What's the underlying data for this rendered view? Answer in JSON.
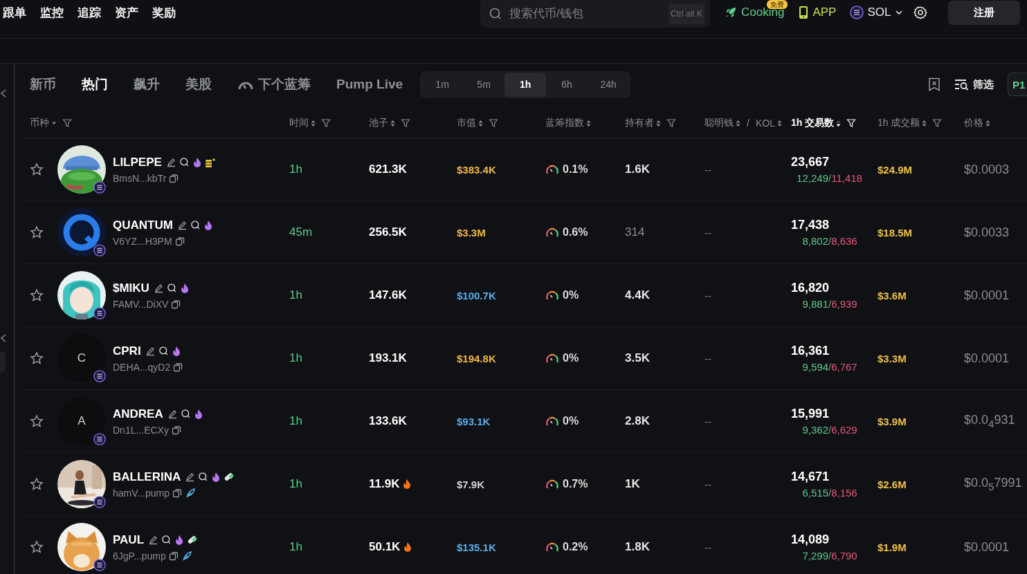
{
  "nav": [
    "跟单",
    "监控",
    "追踪",
    "资产",
    "奖励"
  ],
  "search": {
    "placeholder": "搜索代币/钱包",
    "shortcut": "Ctrl alt K"
  },
  "header_actions": {
    "cooking": {
      "label": "Cooking",
      "badge": "免费"
    },
    "app": "APP",
    "chain": "SOL",
    "signup": "注册"
  },
  "tabs": [
    {
      "label": "新币",
      "selected": false
    },
    {
      "label": "热门",
      "selected": true
    },
    {
      "label": "飙升",
      "selected": false
    },
    {
      "label": "美股",
      "selected": false
    },
    {
      "label": "下个蓝筹",
      "selected": false,
      "kind": "indicator"
    },
    {
      "label": "Pump Live",
      "selected": false
    }
  ],
  "timeframes": [
    {
      "label": "1m",
      "selected": false
    },
    {
      "label": "5m",
      "selected": false
    },
    {
      "label": "1h",
      "selected": true
    },
    {
      "label": "6h",
      "selected": false
    },
    {
      "label": "24h",
      "selected": false
    }
  ],
  "toolbar": {
    "filter": "筛选",
    "preset": "P1"
  },
  "columns": [
    {
      "label": "币种",
      "dropdown": true,
      "filter": true,
      "active": false
    },
    {
      "label": "时间",
      "dropdown": false,
      "sortable": true,
      "sorted_desc": false,
      "filter": true,
      "active": false
    },
    {
      "label": "池子",
      "dropdown": false,
      "sortable": true,
      "sorted_desc": false,
      "filter": true,
      "active": false
    },
    {
      "label": "市值",
      "dropdown": false,
      "sortable": true,
      "sorted_desc": false,
      "filter": true,
      "active": false
    },
    {
      "label": "蓝筹指数",
      "dropdown": false,
      "sortable": true,
      "sorted_desc": false,
      "filter": false,
      "active": false
    },
    {
      "label": "持有者",
      "dropdown": false,
      "sortable": true,
      "sorted_desc": false,
      "filter": true,
      "active": false
    },
    {
      "label": "聪明钱",
      "dropdown": false,
      "sortable": true,
      "sorted_desc": false,
      "filter": false,
      "active": false,
      "separator": "/",
      "label_2": "KOL"
    },
    {
      "label": "1h 交易数",
      "dropdown": false,
      "sortable": true,
      "sorted_desc": true,
      "filter": true,
      "active": true
    },
    {
      "label": "1h 成交额",
      "dropdown": false,
      "sortable": true,
      "sorted_desc": false,
      "filter": true,
      "active": false
    },
    {
      "label": "价格",
      "dropdown": false,
      "sortable": true,
      "sorted_desc": false,
      "filter": false,
      "active": false
    }
  ],
  "rows": [
    {
      "favorite": false,
      "avatar": {
        "kind": "picture"
      },
      "name": "LILPEPE",
      "badges": [
        {
          "kind": "coins"
        }
      ],
      "address": "BmsN...kbTr",
      "social": false,
      "time": "1h",
      "pool": "621.3K",
      "pool_hot": false,
      "market_cap": {
        "value": "$383.4K",
        "color": "#f0b94a"
      },
      "bluechip": "0.1%",
      "holders": {
        "value": "1.6K",
        "dim": false
      },
      "smart_money": "--",
      "txns": "23,667",
      "buys": "12,249",
      "separator": "/",
      "sells": "11,418",
      "volume": "$24.9M",
      "price": "$0.0003"
    },
    {
      "favorite": false,
      "avatar": {
        "kind": "picture"
      },
      "name": "QUANTUM",
      "badges": [],
      "address": "V6YZ...H3PM",
      "social": false,
      "time": "45m",
      "pool": "256.5K",
      "pool_hot": false,
      "market_cap": {
        "value": "$3.3M",
        "color": "#f0b94a"
      },
      "bluechip": "0.6%",
      "holders": {
        "value": "314",
        "dim": true
      },
      "smart_money": "--",
      "txns": "17,438",
      "buys": "8,802",
      "separator": "/",
      "sells": "8,636",
      "volume": "$18.5M",
      "price": "$0.0033"
    },
    {
      "favorite": false,
      "avatar": {
        "kind": "picture"
      },
      "name": "$MIKU",
      "badges": [],
      "address": "FAMV...DiXV",
      "social": false,
      "time": "1h",
      "pool": "147.6K",
      "pool_hot": false,
      "market_cap": {
        "value": "$100.7K",
        "color": "#5aaee8"
      },
      "bluechip": "0%",
      "holders": {
        "value": "4.4K",
        "dim": false
      },
      "smart_money": "--",
      "txns": "16,820",
      "buys": "9,881",
      "separator": "/",
      "sells": "6,939",
      "volume": "$3.6M",
      "price": "$0.0001"
    },
    {
      "favorite": false,
      "avatar": {
        "kind": "letter",
        "letter": "C"
      },
      "name": "CPRI",
      "badges": [],
      "address": "DEHA...qyD2",
      "social": false,
      "time": "1h",
      "pool": "193.1K",
      "pool_hot": false,
      "market_cap": {
        "value": "$194.8K",
        "color": "#f0b94a"
      },
      "bluechip": "0%",
      "holders": {
        "value": "3.5K",
        "dim": false
      },
      "smart_money": "--",
      "txns": "16,361",
      "buys": "9,594",
      "separator": "/",
      "sells": "6,767",
      "volume": "$3.3M",
      "price": "$0.0001"
    },
    {
      "favorite": false,
      "avatar": {
        "kind": "letter",
        "letter": "A"
      },
      "name": "ANDREA",
      "badges": [],
      "address": "Dn1L...ECXy",
      "social": false,
      "time": "1h",
      "pool": "133.6K",
      "pool_hot": false,
      "market_cap": {
        "value": "$93.1K",
        "color": "#5aaee8"
      },
      "bluechip": "0%",
      "holders": {
        "value": "2.8K",
        "dim": false
      },
      "smart_money": "--",
      "txns": "15,991",
      "buys": "9,362",
      "separator": "/",
      "sells": "6,629",
      "volume": "$3.9M",
      "price": "$0.0$_{4}$931"
    },
    {
      "favorite": false,
      "avatar": {
        "kind": "picture"
      },
      "name": "BALLERINA",
      "badges": [
        {
          "kind": "pill"
        }
      ],
      "address": "hamV...pump",
      "social": true,
      "time": "1h",
      "pool": "11.9K",
      "pool_hot": true,
      "market_cap": {
        "value": "$7.9K",
        "color": "#d4d4d8"
      },
      "bluechip": "0.7%",
      "holders": {
        "value": "1K",
        "dim": false
      },
      "smart_money": "--",
      "txns": "14,671",
      "buys": "6,515",
      "separator": "/",
      "sells": "8,156",
      "volume": "$2.6M",
      "price": "$0.0$_{5}$7991"
    },
    {
      "favorite": false,
      "avatar": {
        "kind": "picture"
      },
      "name": "PAUL",
      "badges": [
        {
          "kind": "pill"
        }
      ],
      "address": "6JgP...pump",
      "social": true,
      "time": "1h",
      "pool": "50.1K",
      "pool_hot": true,
      "market_cap": {
        "value": "$135.1K",
        "color": "#5aaee8"
      },
      "bluechip": "0.2%",
      "holders": {
        "value": "1.8K",
        "dim": false
      },
      "smart_money": "--",
      "txns": "14,089",
      "buys": "7,299",
      "separator": "/",
      "sells": "6,790",
      "volume": "$1.9M",
      "price": "$0.0001"
    }
  ]
}
